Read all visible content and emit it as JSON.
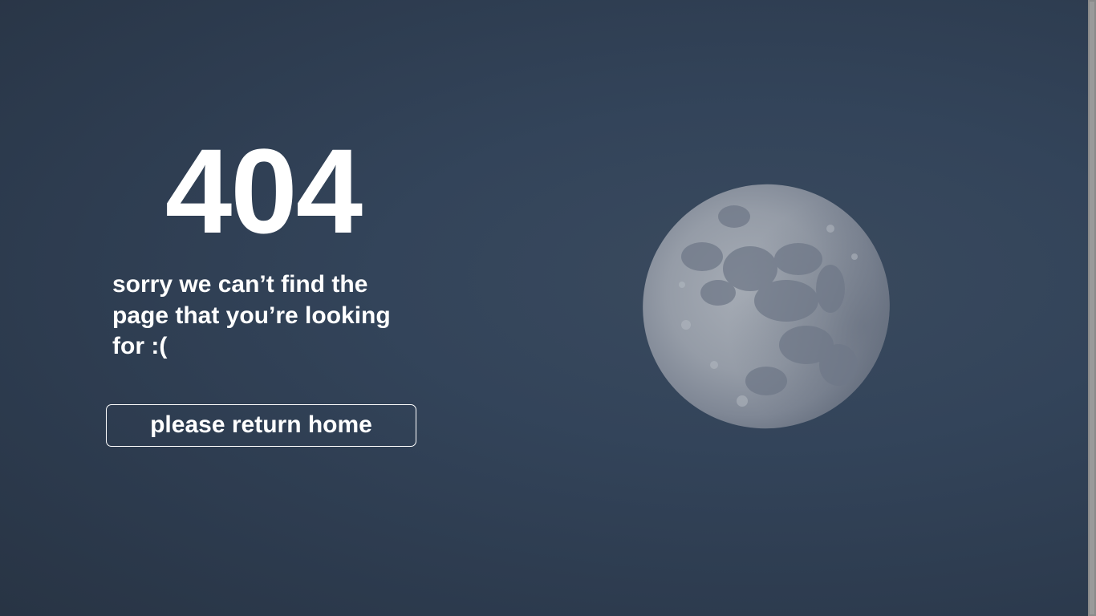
{
  "error": {
    "code": "404",
    "message": "sorry we can’t find the page that you’re looking for :("
  },
  "actions": {
    "home_label": "please return home"
  },
  "background": {
    "image": "moon-icon",
    "sky_color": "#2f3d4f"
  },
  "colors": {
    "text": "#ffffff",
    "button_border": "#ffffff"
  }
}
